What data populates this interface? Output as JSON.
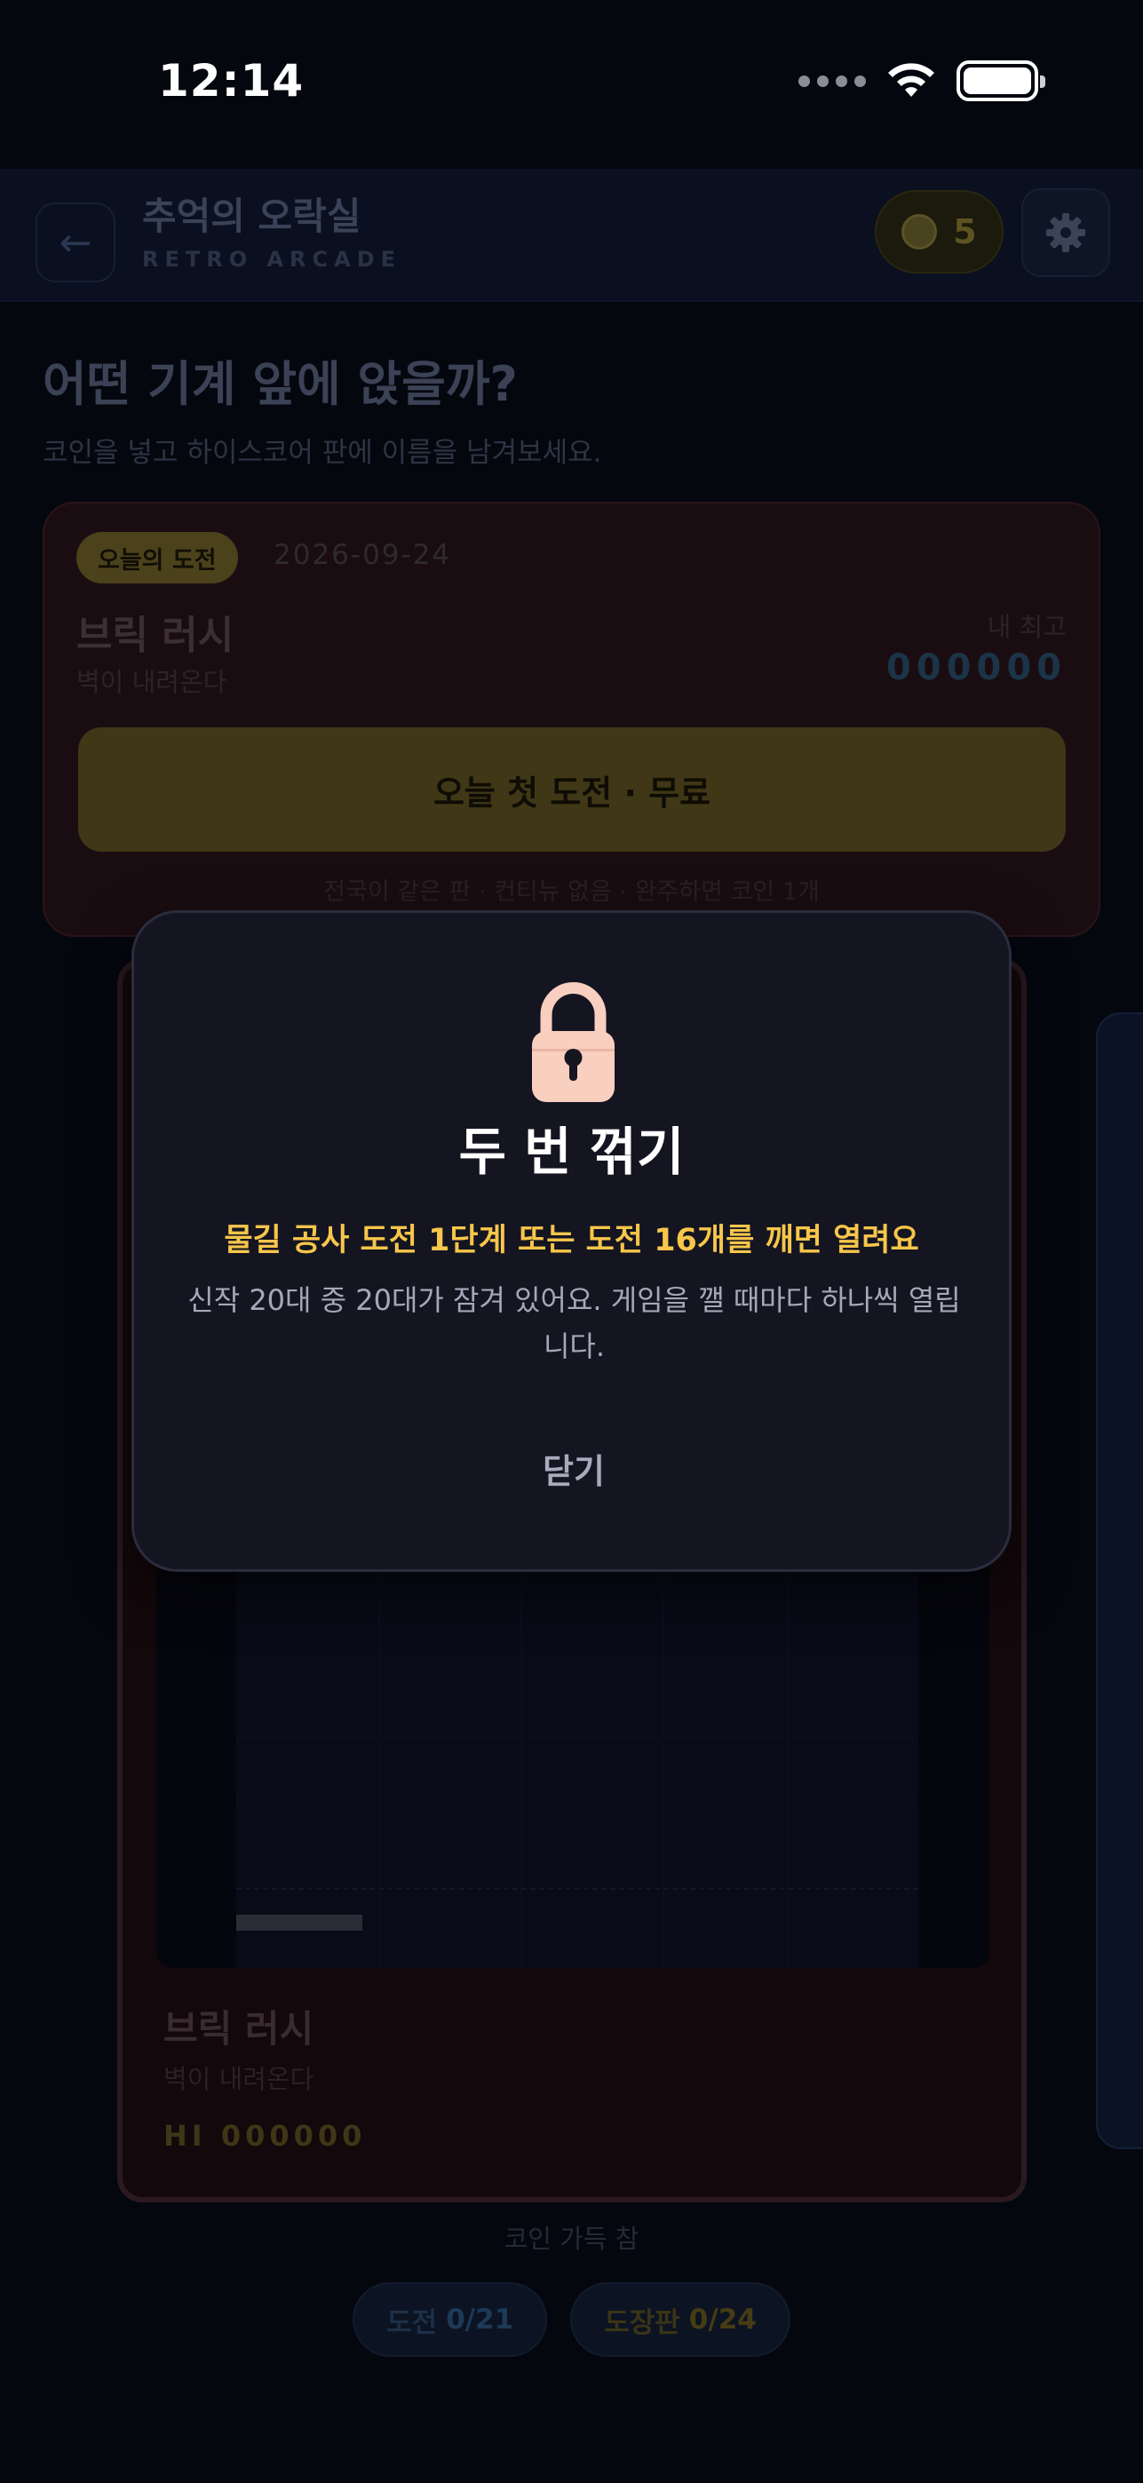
{
  "status_bar": {
    "time": "12:14"
  },
  "header": {
    "back_icon": "arrow-left-icon",
    "title": "추억의 오락실",
    "subtitle": "RETRO ARCADE",
    "coin_count": "5",
    "settings_icon": "gear-icon"
  },
  "page": {
    "heading": "어떤 기계 앞에 앉을까?",
    "description": "코인을 넣고 하이스코어 판에 이름을 남겨보세요."
  },
  "daily": {
    "badge": "오늘의 도전",
    "date": "2026-09-24",
    "game_title": "브릭 러시",
    "game_subtitle": "벽이 내려온다",
    "best_label": "내 최고",
    "best_score": "000000",
    "cta": "오늘 첫 도전 · 무료",
    "note": "전국이 같은 판 · 컨티뉴 없음 · 완주하면 코인 1개"
  },
  "cabinet": {
    "title": "브릭 러시",
    "subtitle": "벽이 내려온다",
    "hi_score": "HI 000000"
  },
  "footer": {
    "coin_full": "코인 가득 참",
    "challenge_label": "도전",
    "challenge_value": "0/21",
    "board_label": "도장판",
    "board_value": "0/24"
  },
  "modal": {
    "icon": "lock-icon",
    "title": "두 번 꺾기",
    "condition": "물길 공사 도전 1단계 또는 도전 16개를 깨면 열려요",
    "description": "신작 20대 중 20대가 잠겨 있어요. 게임을 깰 때마다 하나씩 열립니다.",
    "close_label": "닫기"
  },
  "colors": {
    "background": "#05070f",
    "modal_bg": "#141521",
    "condition_text": "#f7c64a",
    "lock_body": "#f9cfc0"
  }
}
